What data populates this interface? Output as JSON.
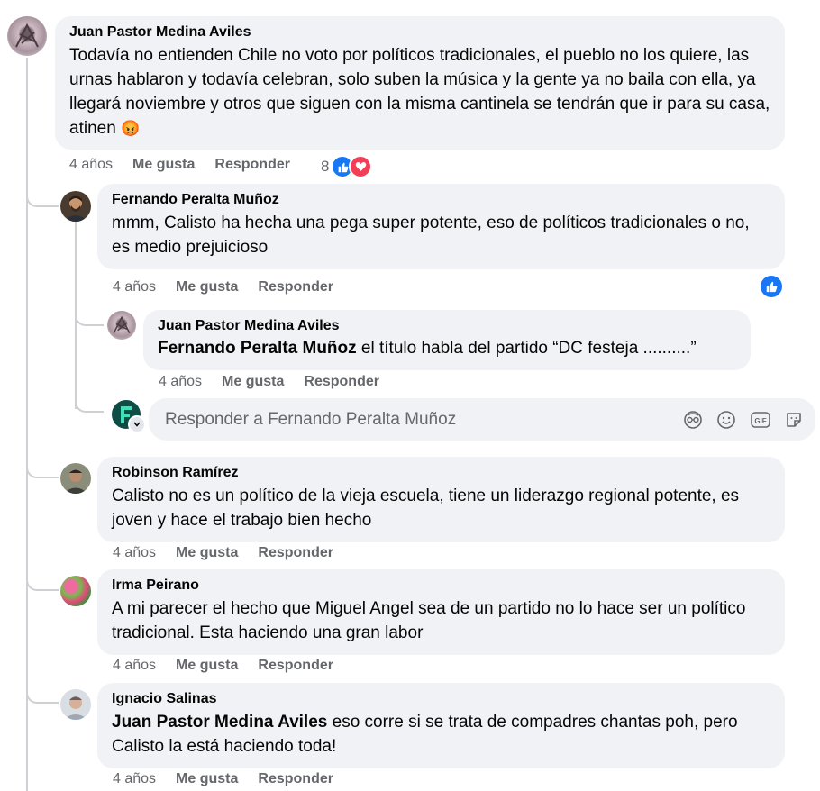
{
  "comments": [
    {
      "author": "Juan Pastor Medina Aviles",
      "text": "Todavía no entienden Chile no voto por políticos tradicionales, el pueblo no los quiere, las urnas hablaron y todavía celebran, solo suben la música y la gente ya no baila con ella, ya llegará noviembre y otros que siguen con la misma cantinela se tendrán que ir para su casa, atinen",
      "emoji": "😡",
      "time": "4 años",
      "like": "Me gusta",
      "reply": "Responder",
      "reaction_count": "8"
    },
    {
      "author": "Fernando Peralta Muñoz",
      "text": "mmm, Calisto ha hecha una pega super potente, eso de políticos tradicionales o no, es medio prejuicioso",
      "time": "4 años",
      "like": "Me gusta",
      "reply": "Responder"
    },
    {
      "author": "Juan Pastor Medina Aviles",
      "mention": "Fernando Peralta Muñoz",
      "text": " el título habla del partido “DC festeja ..........”",
      "time": "4 años",
      "like": "Me gusta",
      "reply": "Responder"
    },
    {
      "author": "Robinson Ramírez",
      "text": "Calisto no es un político de la vieja escuela, tiene un liderazgo regional potente, es joven y hace el trabajo bien hecho",
      "time": "4 años",
      "like": "Me gusta",
      "reply": "Responder"
    },
    {
      "author": "Irma Peirano",
      "text": "A mi parecer el hecho que Miguel Angel sea de un partido no lo hace ser un político tradicional. Esta haciendo una gran labor",
      "time": "4 años",
      "like": "Me gusta",
      "reply": "Responder"
    },
    {
      "author": "Ignacio Salinas",
      "mention": "Juan Pastor Medina Aviles",
      "text": " eso corre si se trata de compadres chantas poh, pero Calisto la está haciendo toda!",
      "time": "4 años",
      "like": "Me gusta",
      "reply": "Responder"
    }
  ],
  "reply_box": {
    "placeholder": "Responder a Fernando Peralta Muñoz"
  },
  "colors": {
    "like_blue": "#1877f2",
    "love_red": "#f33e58",
    "bubble_bg": "#f0f2f5",
    "meta_gray": "#65676b"
  }
}
